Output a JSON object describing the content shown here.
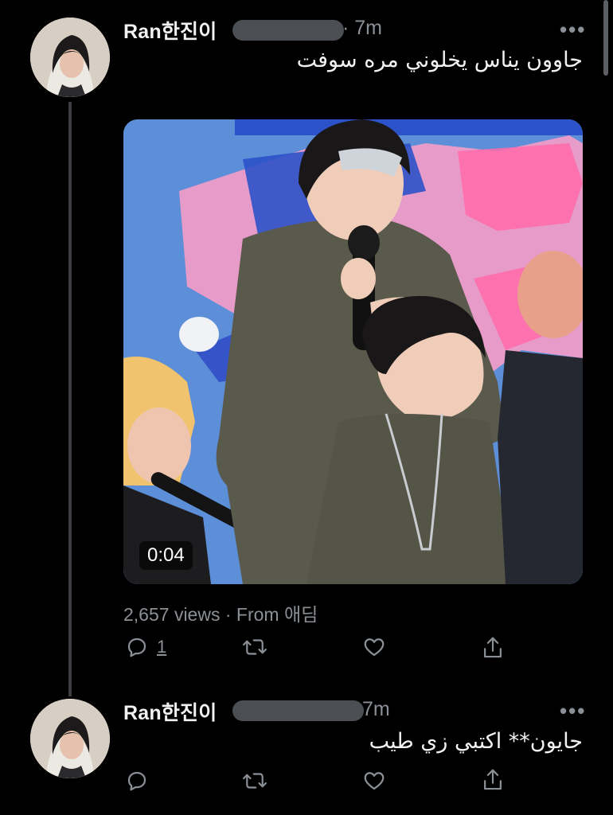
{
  "tweets": [
    {
      "display_name": "Ran한진이",
      "time": "· 7m",
      "text": "جاوون يناس يخلوني مره سوفت",
      "video": {
        "duration": "0:04"
      },
      "meta": "2,657 views · From 애딤",
      "actions": {
        "reply_count": "1"
      }
    },
    {
      "display_name": "Ran한진이",
      "time": "7m",
      "text": "جايون** اكتبي زي طيب"
    }
  ],
  "more_label": "•••"
}
